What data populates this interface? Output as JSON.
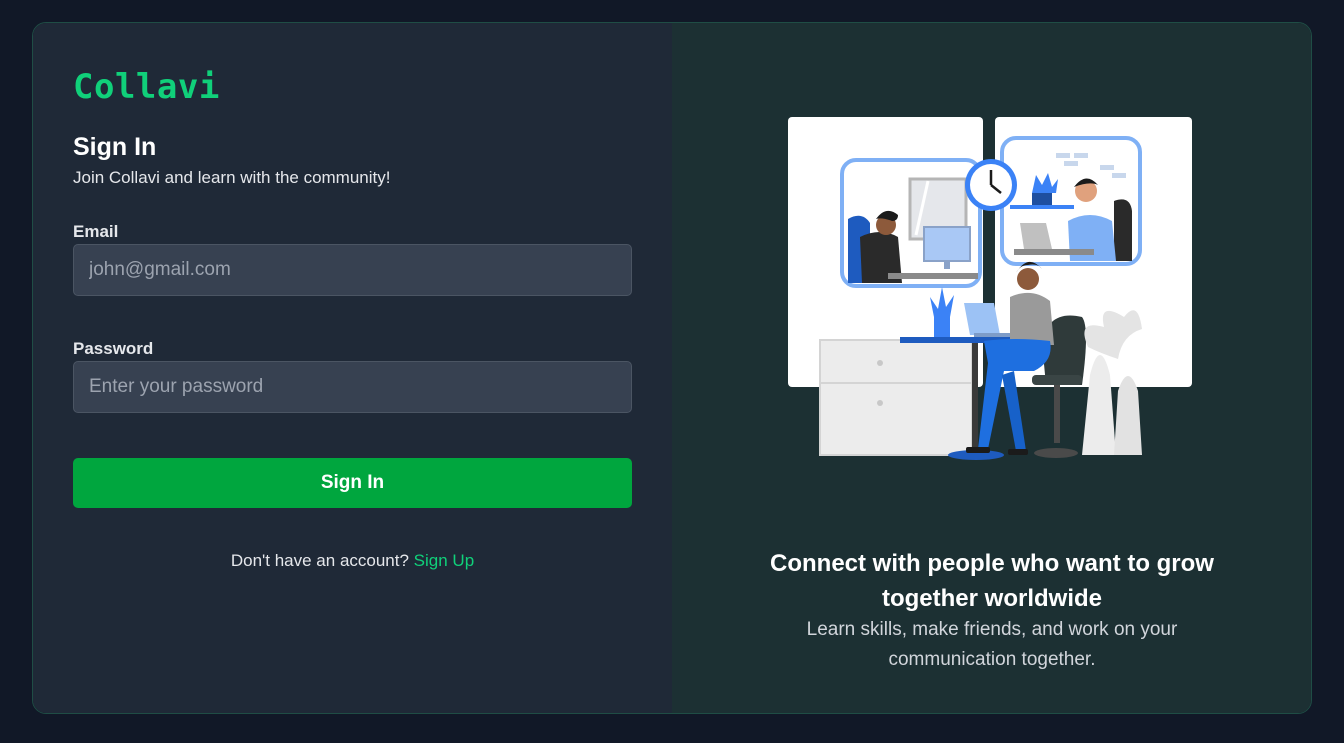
{
  "brand": {
    "logo": "Collavi",
    "accent": "#10d07a"
  },
  "signin": {
    "title": "Sign In",
    "subtitle": "Join Collavi and learn with the community!",
    "email_label": "Email",
    "email_placeholder": "john@gmail.com",
    "password_label": "Password",
    "password_placeholder": "Enter your password",
    "submit_label": "Sign In",
    "footer_text": "Don't have an account?",
    "signup_link": "Sign Up",
    "button_color": "#00a63e"
  },
  "promo": {
    "illustration": "remote-work-illustration",
    "headline": "Connect with people who want to grow together worldwide",
    "description": "Learn skills, make friends, and work on your communication together."
  }
}
